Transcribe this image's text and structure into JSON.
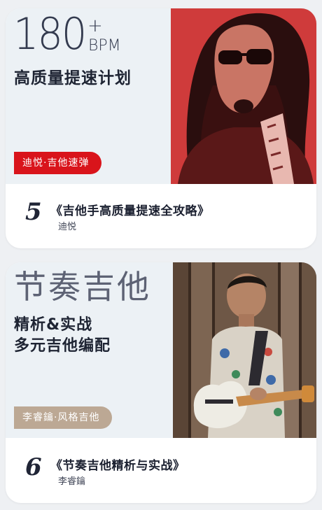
{
  "cards": [
    {
      "banner_big": "180",
      "banner_plus": "+",
      "banner_unit": "BPM",
      "headline": "高质量提速计划",
      "tag": "迪悦·吉他速弹",
      "tag_color": "#d9141b",
      "episode": "5",
      "book_title": "《吉他手高质量提速全攻略》",
      "author": "迪悦"
    },
    {
      "banner_big": "节奏吉他",
      "headline_line1": "精析&实战",
      "headline_line2": "多元吉他编配",
      "tag": "李睿鑰·风格吉他",
      "tag_color": "#bca894",
      "episode": "6",
      "book_title": "《节奏吉他精析与实战》",
      "author": "李睿鑰"
    }
  ],
  "colors": {
    "page_background": "#eef0f3",
    "banner_background": "#ecf1f5",
    "title_text": "#1e2433",
    "photo_1_tint": "#d13c3c"
  }
}
